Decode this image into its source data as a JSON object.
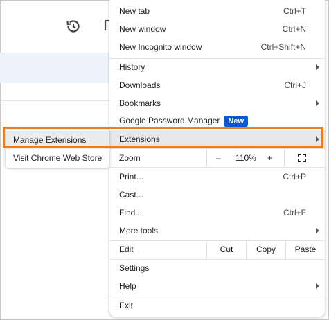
{
  "menu": {
    "new_tab": {
      "label": "New tab",
      "shortcut": "Ctrl+T"
    },
    "new_window": {
      "label": "New window",
      "shortcut": "Ctrl+N"
    },
    "new_incognito": {
      "label": "New Incognito window",
      "shortcut": "Ctrl+Shift+N"
    },
    "history": {
      "label": "History"
    },
    "downloads": {
      "label": "Downloads",
      "shortcut": "Ctrl+J"
    },
    "bookmarks": {
      "label": "Bookmarks"
    },
    "password_manager": {
      "label": "Google Password Manager",
      "badge": "New"
    },
    "extensions": {
      "label": "Extensions"
    },
    "zoom": {
      "label": "Zoom",
      "minus": "–",
      "value": "110%",
      "plus": "+"
    },
    "print": {
      "label": "Print...",
      "shortcut": "Ctrl+P"
    },
    "cast": {
      "label": "Cast..."
    },
    "find": {
      "label": "Find...",
      "shortcut": "Ctrl+F"
    },
    "more_tools": {
      "label": "More tools"
    },
    "edit": {
      "label": "Edit",
      "cut": "Cut",
      "copy": "Copy",
      "paste": "Paste"
    },
    "settings": {
      "label": "Settings"
    },
    "help": {
      "label": "Help"
    },
    "exit": {
      "label": "Exit"
    }
  },
  "submenu": {
    "manage_extensions": "Manage Extensions",
    "visit_store": "Visit Chrome Web Store"
  },
  "colors": {
    "highlight_outline": "#f07c1a",
    "badge_bg": "#0b57d0"
  },
  "icons": {
    "history": "history-icon",
    "fullscreen": "fullscreen-icon"
  }
}
